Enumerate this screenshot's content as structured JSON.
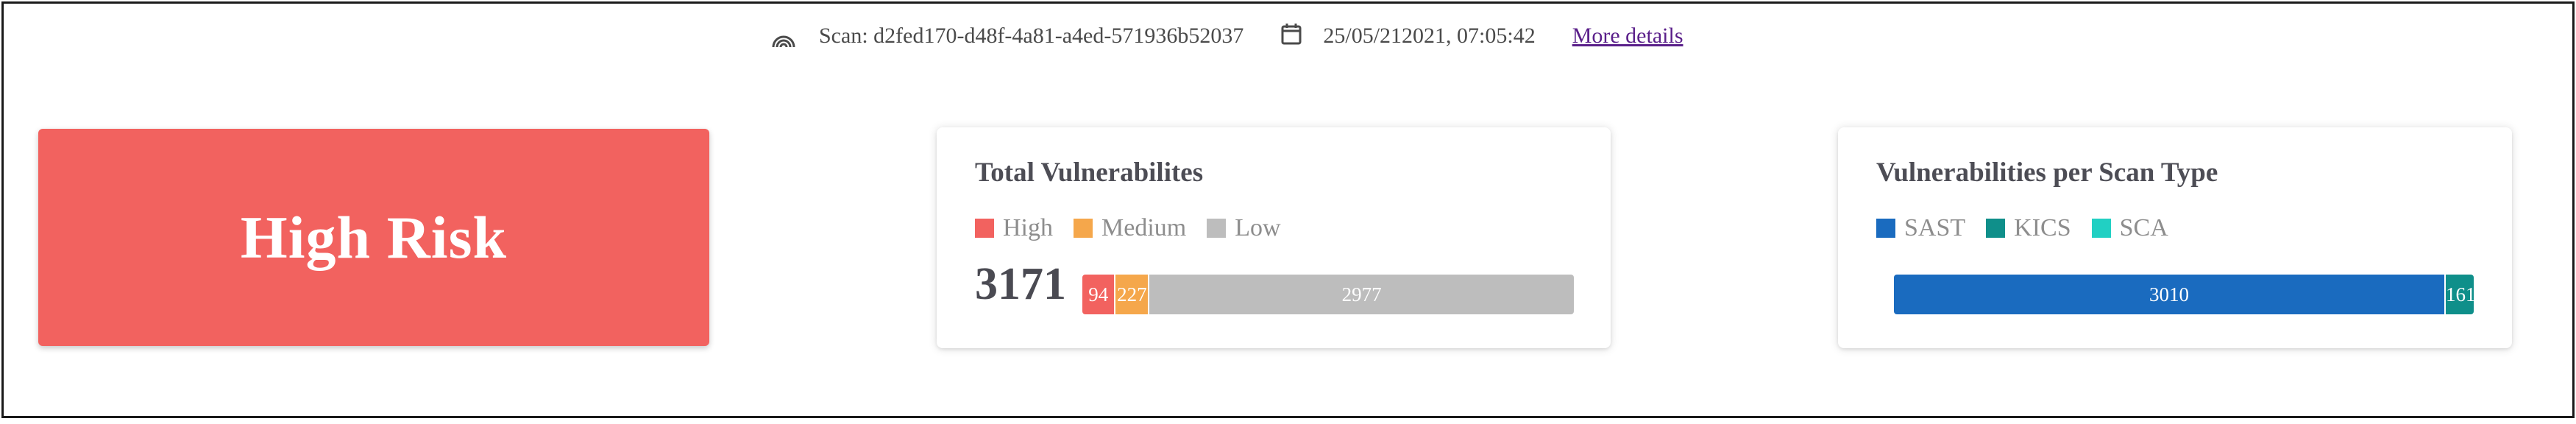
{
  "header": {
    "scan_label": "Scan: d2fed170-d48f-4a81-a4ed-571936b52037",
    "date_label": "25/05/212021, 07:05:42",
    "more_details_label": "More details",
    "icons": [
      "scan-icon",
      "calendar-icon"
    ]
  },
  "risk": {
    "label": "High Risk",
    "color": "#f2625f"
  },
  "total_vulnerabilities": {
    "title": "Total Vulnerabilites",
    "total": "3171",
    "legend": [
      {
        "label": "High",
        "color": "#f2625f"
      },
      {
        "label": "Medium",
        "color": "#f5a74b"
      },
      {
        "label": "Low",
        "color": "#bdbdbd"
      }
    ],
    "segments": [
      {
        "label": "High",
        "value": 94,
        "color": "#f2625f"
      },
      {
        "label": "Medium",
        "value": 227,
        "color": "#f5a74b"
      },
      {
        "label": "Low",
        "value": 2977,
        "color": "#bdbdbd"
      }
    ]
  },
  "scan_types": {
    "title": "Vulnerabilities per Scan Type",
    "legend": [
      {
        "label": "SAST",
        "color": "#1a6bbf"
      },
      {
        "label": "KICS",
        "color": "#0f8f8a"
      },
      {
        "label": "SCA",
        "color": "#21d0c3"
      }
    ],
    "segments": [
      {
        "label": "SAST",
        "value": 3010,
        "color": "#1a6bbf"
      },
      {
        "label": "KICS",
        "value": 161,
        "color": "#0f8f8a"
      }
    ]
  }
}
